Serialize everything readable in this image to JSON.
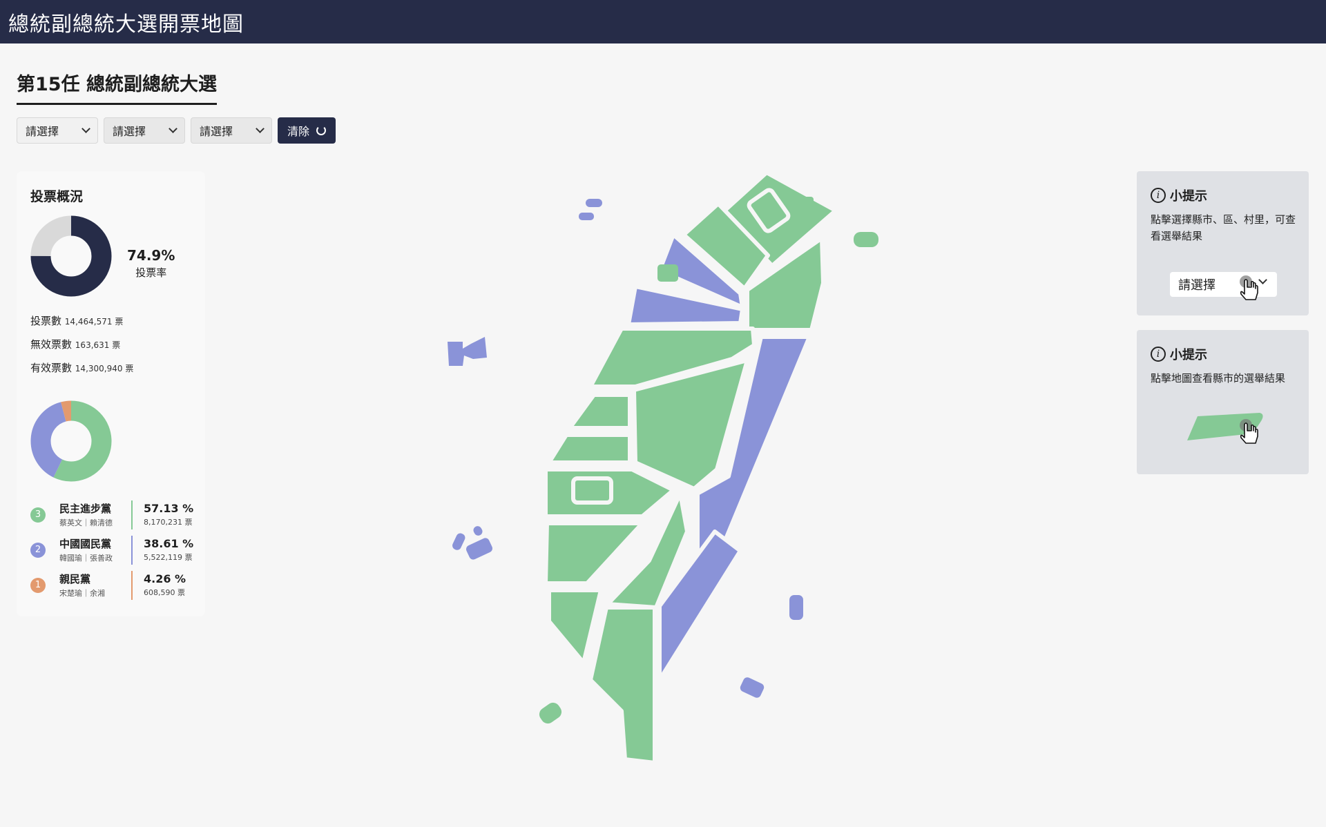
{
  "app": {
    "title": "總統副總統大選開票地圖"
  },
  "election": {
    "title": "第15任 總統副總統大選"
  },
  "filters": {
    "county_label": "請選擇",
    "district_label": "請選擇",
    "village_label": "請選擇",
    "clear_label": "清除"
  },
  "overview": {
    "title": "投票概況",
    "turnout_pct": "74.9%",
    "turnout_value": 74.9,
    "turnout_label": "投票率",
    "stats": [
      {
        "label": "投票數",
        "value": "14,464,571 票"
      },
      {
        "label": "無效票數",
        "value": "163,631 票"
      },
      {
        "label": "有效票數",
        "value": "14,300,940 票"
      }
    ]
  },
  "candidates": [
    {
      "number": "3",
      "party": "民主進步黨",
      "pair": "蔡英文｜賴清德",
      "pct": "57.13 %",
      "votes": "8,170,231 票",
      "share": 57.13,
      "color": "#85c995"
    },
    {
      "number": "2",
      "party": "中國國民黨",
      "pair": "韓國瑜｜張善政",
      "pct": "38.61 %",
      "votes": "5,522,119 票",
      "share": 38.61,
      "color": "#8a93d8"
    },
    {
      "number": "1",
      "party": "親民黨",
      "pair": "宋楚瑜｜余湘",
      "pct": "4.26 %",
      "votes": "608,590 票",
      "share": 4.26,
      "color": "#e39a6e"
    }
  ],
  "colors": {
    "dpp": "#85c995",
    "kmt": "#8a93d8",
    "pfp": "#e39a6e",
    "navy": "#262c48",
    "turnout_rest": "#d9d9d9"
  },
  "tips": [
    {
      "title": "小提示",
      "text": "點擊選擇縣市、區、村里，可查看選舉結果",
      "demo_label": "請選擇"
    },
    {
      "title": "小提示",
      "text": "點擊地圖查看縣市的選舉結果"
    }
  ]
}
